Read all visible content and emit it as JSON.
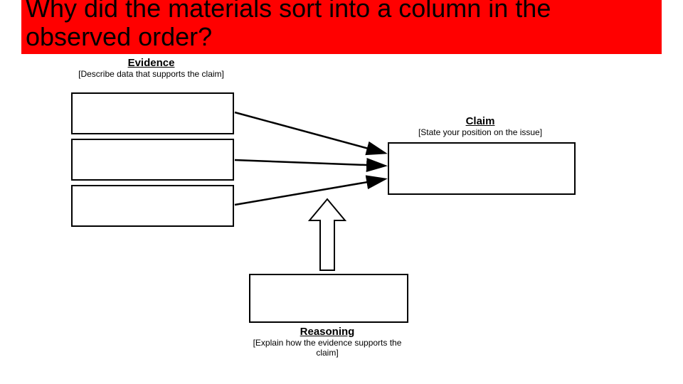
{
  "title": "Why did the materials sort into a column in the observed order?",
  "evidence": {
    "heading": "Evidence",
    "sub": "[Describe data that supports the claim]"
  },
  "claim": {
    "heading": "Claim",
    "sub": "[State your position on the issue]"
  },
  "reasoning": {
    "heading": "Reasoning",
    "sub": "[Explain how the evidence supports the claim]"
  }
}
